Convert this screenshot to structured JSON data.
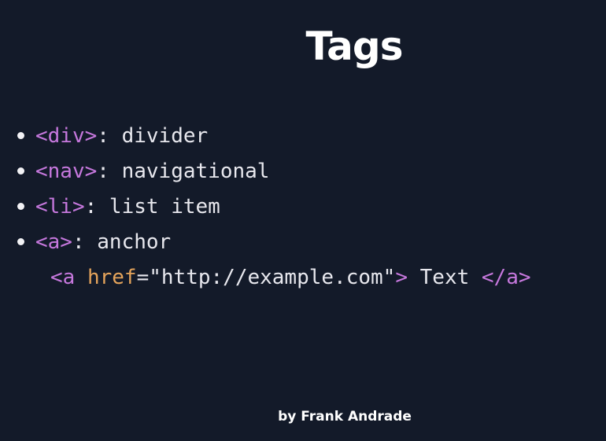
{
  "slide": {
    "title": "Tags",
    "bullets": [
      {
        "tag": "<div>",
        "text": ": divider"
      },
      {
        "tag": "<nav>",
        "text": ": navigational"
      },
      {
        "tag": "<li>",
        "text": ": list item"
      },
      {
        "tag": "<a>",
        "text": ": anchor"
      }
    ],
    "code_example": {
      "open_tag_start": "<a",
      "attr_name": "href",
      "attr_eq_value": "=\"http://example.com\"",
      "open_tag_end": ">",
      "text": " Text ",
      "close_tag": "</a>"
    },
    "footer": "by Frank Andrade"
  },
  "colors": {
    "background": "#131a29",
    "tag": "#c678dd",
    "attribute": "#e5a45b",
    "text": "#e8e8ee"
  }
}
